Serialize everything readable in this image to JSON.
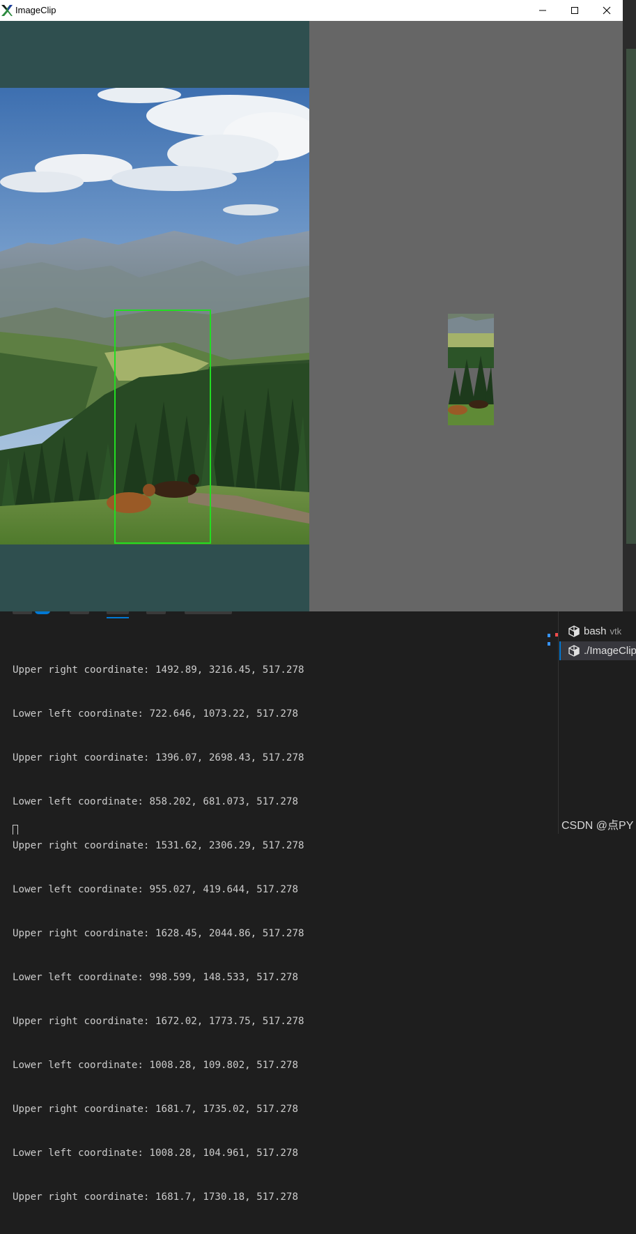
{
  "window": {
    "title": "ImageClip",
    "accent_logo": "#2b8a3e"
  },
  "viewports": {
    "left_background": "#2f4f4f",
    "right_background": "#666666",
    "selection_color": "#22dd22"
  },
  "terminal": {
    "lines": [
      "Upper right coordinate: 1492.89, 3216.45, 517.278",
      "Lower left coordinate: 722.646, 1073.22, 517.278",
      "Upper right coordinate: 1396.07, 2698.43, 517.278",
      "Lower left coordinate: 858.202, 681.073, 517.278",
      "Upper right coordinate: 1531.62, 2306.29, 517.278",
      "Lower left coordinate: 955.027, 419.644, 517.278",
      "Upper right coordinate: 1628.45, 2044.86, 517.278",
      "Lower left coordinate: 998.599, 148.533, 517.278",
      "Upper right coordinate: 1672.02, 1773.75, 517.278",
      "Lower left coordinate: 1008.28, 109.802, 517.278",
      "Upper right coordinate: 1681.7, 1735.02, 517.278",
      "Lower left coordinate: 1008.28, 104.961, 517.278",
      "Upper right coordinate: 1681.7, 1730.18, 517.278"
    ]
  },
  "sessions": [
    {
      "label": "bash",
      "sub": "vtk"
    },
    {
      "label": "./ImageClip",
      "sub": ""
    }
  ],
  "watermark": "CSDN @点PY"
}
